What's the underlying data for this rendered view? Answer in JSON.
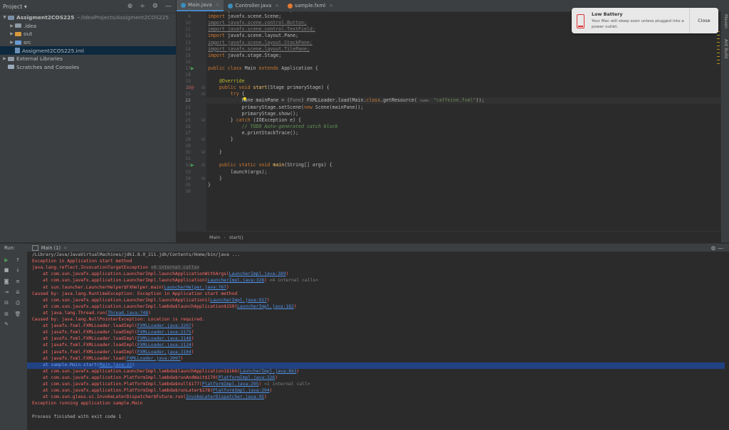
{
  "project": {
    "header_label": "Project",
    "tree": [
      {
        "label": "Assigment2COS225",
        "suffix": "~/IdeaProjects/Assigment2COS225",
        "type": "module",
        "indent": 0,
        "arrow": "down",
        "bold": true
      },
      {
        "label": ".idea",
        "type": "folder-gray",
        "indent": 1,
        "arrow": "right"
      },
      {
        "label": "out",
        "type": "folder-orange",
        "indent": 1,
        "arrow": "right"
      },
      {
        "label": "src",
        "type": "folder-blue",
        "indent": 1,
        "arrow": "right"
      },
      {
        "label": "Assigment2COS225.iml",
        "type": "file",
        "indent": 1,
        "arrow": "",
        "selected": true
      },
      {
        "label": "External Libraries",
        "type": "libs",
        "indent": 0,
        "arrow": "right"
      },
      {
        "label": "Scratches and Consoles",
        "type": "scratch",
        "indent": 0,
        "arrow": ""
      }
    ]
  },
  "tabs": [
    {
      "label": "Main.java",
      "active": true,
      "icon_color": "#3c8dbc"
    },
    {
      "label": "Controller.java",
      "active": false,
      "icon_color": "#3c8dbc"
    },
    {
      "label": "sample.fxml",
      "active": false,
      "icon_color": "#e37933"
    }
  ],
  "right_strip": {
    "maven": "Maven",
    "ant": "Ant Build"
  },
  "notification": {
    "title": "Low Battery",
    "body": "Your Mac will sleep soon unless plugged into a power outlet.",
    "close": "Close"
  },
  "editor": {
    "current_line": 22,
    "breadcrumb": [
      "Main",
      "start()"
    ]
  },
  "run": {
    "label": "Run:",
    "tab": "Main (1)"
  }
}
